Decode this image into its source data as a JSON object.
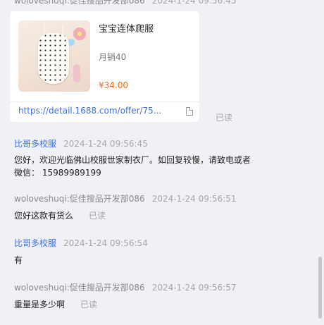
{
  "messages_top": {
    "sender": "woloveshuqi:促佳搜品开发部086",
    "time": "2024-1-24 09:56:45"
  },
  "product_card": {
    "title": "宝宝连体爬服",
    "sales": "月销40",
    "price": "¥34.00",
    "link": "https://detail.1688.com/offer/75...",
    "read_status": "已读"
  },
  "msg1": {
    "sender": "比哥多校服",
    "time": "2024-1-24 09:56:45",
    "line1": "您好，欢迎光临佛山校服世家制衣厂。如回复较慢，请致电或者",
    "line2": "微信：  15989989199"
  },
  "msg2": {
    "sender": "woloveshuqi:促佳搜品开发部086",
    "time": "2024-1-24 09:56:51",
    "text": "您好这款有货么",
    "read_status": "已读"
  },
  "msg3": {
    "sender": "比哥多校服",
    "time": "2024-1-24 09:56:54",
    "text": "有"
  },
  "msg4": {
    "sender": "woloveshuqi:促佳搜品开发部086",
    "time": "2024-1-24 09:56:57",
    "text": "重量是多少啊",
    "read_status": "已读"
  },
  "colors": {
    "background": "#f0f1f5",
    "seller_name": "#3f6fd8",
    "price": "#f26a1b",
    "link": "#3f6fd8"
  }
}
